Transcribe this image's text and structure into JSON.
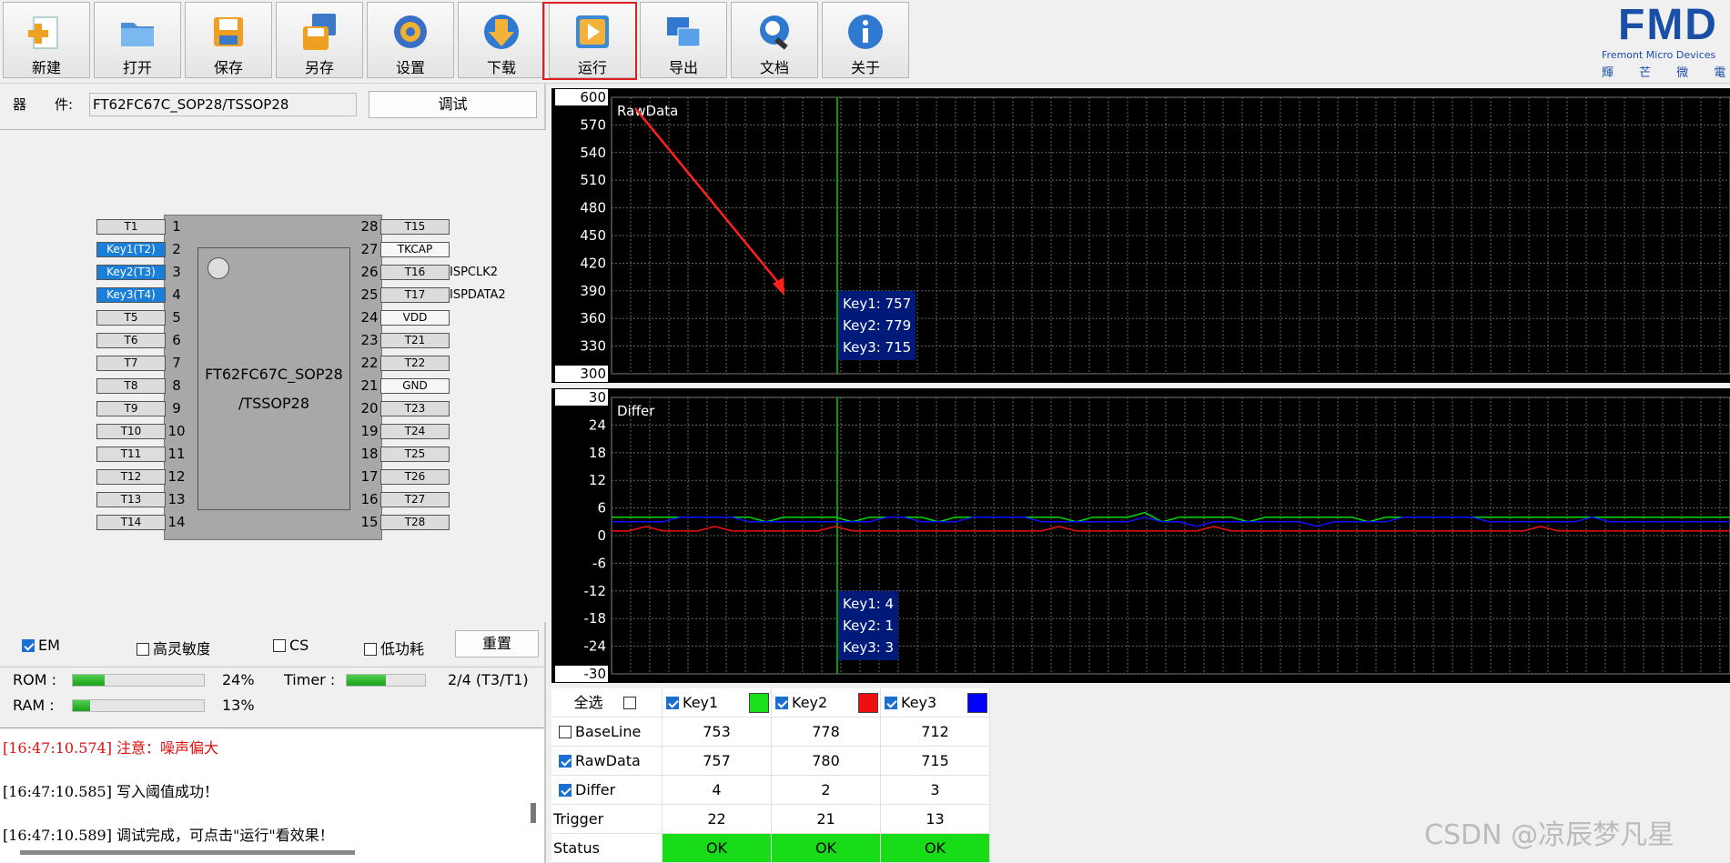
{
  "toolbar": {
    "buttons": [
      {
        "label": "新建",
        "icon": "new-file-icon"
      },
      {
        "label": "打开",
        "icon": "folder-open-icon"
      },
      {
        "label": "保存",
        "icon": "save-icon"
      },
      {
        "label": "另存",
        "icon": "save-as-icon"
      },
      {
        "label": "设置",
        "icon": "settings-gear-icon"
      },
      {
        "label": "下载",
        "icon": "download-icon"
      },
      {
        "label": "运行",
        "icon": "run-play-icon"
      },
      {
        "label": "导出",
        "icon": "export-windows-icon"
      },
      {
        "label": "文档",
        "icon": "document-search-icon"
      },
      {
        "label": "关于",
        "icon": "info-icon"
      }
    ],
    "logo": {
      "text": "FMD",
      "subtitle": "Fremont Micro Devices",
      "cn": "輝 芒 微 電 子"
    }
  },
  "device": {
    "label_a": "器",
    "label_b": "件:",
    "value": "FT62FC67C_SOP28/TSSOP28",
    "debug_button": "调试"
  },
  "chip": {
    "name_line1": "FT62FC67C_SOP28",
    "name_line2": "/TSSOP28",
    "left_pins": [
      "T1",
      "Key1(T2)",
      "Key2(T3)",
      "Key3(T4)",
      "T5",
      "T6",
      "T7",
      "T8",
      "T9",
      "T10",
      "T11",
      "T12",
      "T13",
      "T14"
    ],
    "right_pins": [
      "T15",
      "TKCAP",
      "T16",
      "T17",
      "VDD",
      "T21",
      "T22",
      "GND",
      "T23",
      "T24",
      "T25",
      "T26",
      "T27",
      "T28"
    ],
    "right_numbers": [
      "28",
      "27",
      "26",
      "25",
      "24",
      "23",
      "22",
      "21",
      "20",
      "19",
      "18",
      "17",
      "16",
      "15"
    ],
    "left_numbers": [
      "1",
      "2",
      "3",
      "4",
      "5",
      "6",
      "7",
      "8",
      "9",
      "10",
      "11",
      "12",
      "13",
      "14"
    ],
    "ext_26": "ISPCLK2",
    "ext_25": "ISPDATA2"
  },
  "options": {
    "em": "EM",
    "high_sens": "高灵敏度",
    "cs": "CS",
    "low_power": "低功耗",
    "reset_button": "重置"
  },
  "usage": {
    "rom_label": "ROM :",
    "rom_percent": "24%",
    "rom_fraction": 0.24,
    "ram_label": "RAM :",
    "ram_percent": "13%",
    "ram_fraction": 0.13,
    "timer_label": "Timer :",
    "timer_value": "2/4 (T3/T1)",
    "timer_fraction": 0.5
  },
  "log": [
    {
      "text": "[16:47:10.574] 注意：噪声偏大",
      "color": "#e01010"
    },
    {
      "text": "[16:47:10.585] 写入阈值成功！",
      "color": "#000000"
    },
    {
      "text": "[16:47:10.589] 调试完成，可点击\"运行\"看效果！",
      "color": "#000000"
    }
  ],
  "chart_data": [
    {
      "type": "line",
      "title": "RawData",
      "ylim": [
        300,
        600
      ],
      "yticks": [
        "600",
        "570",
        "540",
        "510",
        "480",
        "450",
        "420",
        "390",
        "360",
        "330",
        "300"
      ],
      "tooltip": [
        "Key1: 757",
        "Key2: 779",
        "Key3: 715"
      ],
      "series": [],
      "grid": true
    },
    {
      "type": "line",
      "title": "Differ",
      "ylim": [
        -30,
        30
      ],
      "yticks": [
        "30",
        "24",
        "18",
        "12",
        "6",
        "0",
        "-6",
        "-12",
        "-18",
        "-24",
        "-30"
      ],
      "tooltip": [
        "Key1: 4",
        "Key2: 1",
        "Key3: 3"
      ],
      "series": [
        {
          "color": "#00dd00",
          "values": [
            4,
            4,
            4,
            4,
            4,
            4,
            4,
            4,
            4,
            3,
            4,
            4,
            4,
            4,
            3,
            4,
            4,
            4,
            4,
            3,
            4,
            4,
            4,
            4,
            4,
            4,
            4,
            3,
            4,
            4,
            4,
            5,
            3,
            4,
            4,
            4,
            4,
            3,
            4,
            4,
            4,
            4,
            4,
            4,
            3,
            4,
            4,
            4,
            4,
            4,
            4,
            4,
            4,
            4,
            4,
            4,
            4,
            4,
            4,
            4,
            4,
            4,
            4,
            4,
            4,
            4
          ]
        },
        {
          "color": "#1010ff",
          "values": [
            3,
            3,
            3,
            3,
            4,
            4,
            4,
            4,
            3,
            3,
            3,
            3,
            3,
            3,
            3,
            3,
            4,
            4,
            3,
            3,
            3,
            4,
            4,
            4,
            4,
            3,
            3,
            3,
            3,
            3,
            3,
            4,
            3,
            3,
            2,
            3,
            3,
            3,
            3,
            3,
            3,
            2,
            3,
            3,
            3,
            3,
            4,
            4,
            4,
            4,
            4,
            3,
            3,
            3,
            3,
            3,
            3,
            4,
            3,
            3,
            3,
            3,
            3,
            3,
            3,
            3
          ]
        },
        {
          "color": "#ee1010",
          "values": [
            1,
            1,
            2,
            1,
            1,
            1,
            2,
            1,
            1,
            1,
            1,
            1,
            1,
            2,
            1,
            1,
            1,
            1,
            1,
            1,
            1,
            1,
            1,
            1,
            1,
            1,
            2,
            1,
            1,
            1,
            1,
            1,
            1,
            1,
            1,
            2,
            1,
            1,
            1,
            1,
            1,
            1,
            1,
            1,
            1,
            1,
            1,
            1,
            1,
            1,
            1,
            1,
            1,
            1,
            2,
            1,
            1,
            1,
            1,
            1,
            1,
            1,
            1,
            1,
            1,
            1
          ]
        }
      ],
      "grid": true
    }
  ],
  "table": {
    "select_all": "全选",
    "keys": [
      {
        "name": "Key1",
        "color": "#1de01d"
      },
      {
        "name": "Key2",
        "color": "#ee1010"
      },
      {
        "name": "Key3",
        "color": "#0000ff"
      }
    ],
    "rows": [
      {
        "label": "BaseLine",
        "checkbox": true,
        "checked": false,
        "values": [
          "753",
          "778",
          "712"
        ]
      },
      {
        "label": "RawData",
        "checkbox": true,
        "checked": true,
        "values": [
          "757",
          "780",
          "715"
        ]
      },
      {
        "label": "Differ",
        "checkbox": true,
        "checked": true,
        "values": [
          "4",
          "2",
          "3"
        ]
      },
      {
        "label": "Trigger",
        "checkbox": false,
        "values": [
          "22",
          "21",
          "13"
        ]
      },
      {
        "label": "Status",
        "checkbox": false,
        "values": [
          "OK",
          "OK",
          "OK"
        ]
      }
    ]
  },
  "watermark": "CSDN @凉辰梦凡星"
}
